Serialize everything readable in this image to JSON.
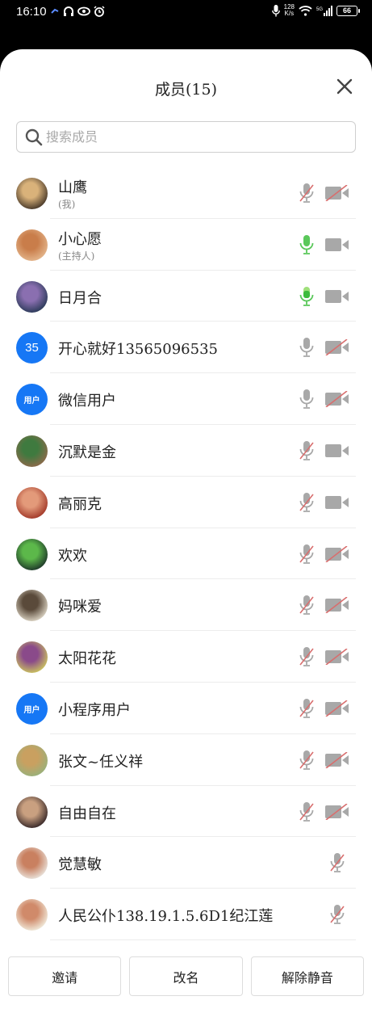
{
  "status_bar": {
    "time": "16:10",
    "speed_value": "128",
    "speed_unit": "K/s",
    "network": "5G",
    "battery": "66"
  },
  "header": {
    "title": "成员(15)"
  },
  "search": {
    "placeholder": "搜索成员",
    "value": ""
  },
  "colors": {
    "accent_blue": "#1677f5",
    "mic_active_green": "#5ac85a",
    "muted_red_slash": "#d86e6e",
    "icon_gray": "#a8a8a8"
  },
  "members": [
    {
      "name": "山鹰",
      "role": "(我)",
      "avatar_type": "photo",
      "avatar_colors": [
        "#4a3a2a",
        "#d9b27a"
      ],
      "mic": "muted",
      "camera": "off"
    },
    {
      "name": "小心愿",
      "role": "(主持人)",
      "avatar_type": "photo",
      "avatar_colors": [
        "#e3b48a",
        "#c97d4a"
      ],
      "mic": "active",
      "camera": "on"
    },
    {
      "name": "日月合",
      "role": "",
      "avatar_type": "photo",
      "avatar_colors": [
        "#2c3b5a",
        "#8a6fb0"
      ],
      "mic": "speaking",
      "camera": "on"
    },
    {
      "name": "开心就好13565096535",
      "role": "",
      "avatar_type": "text",
      "avatar_text": "35",
      "mic": "on",
      "camera": "off"
    },
    {
      "name": "微信用户",
      "role": "",
      "avatar_type": "text",
      "avatar_text": "用户",
      "mic": "on",
      "camera": "off"
    },
    {
      "name": "沉默是金",
      "role": "",
      "avatar_type": "photo",
      "avatar_colors": [
        "#8a6a4a",
        "#3f7a3f"
      ],
      "mic": "muted",
      "camera": "on"
    },
    {
      "name": "高丽克",
      "role": "",
      "avatar_type": "photo",
      "avatar_colors": [
        "#a33a2a",
        "#e39a7a"
      ],
      "mic": "muted",
      "camera": "on"
    },
    {
      "name": "欢欢",
      "role": "",
      "avatar_type": "photo",
      "avatar_colors": [
        "#1f3a2a",
        "#5cb84a"
      ],
      "mic": "muted",
      "camera": "off"
    },
    {
      "name": "妈咪爱",
      "role": "",
      "avatar_type": "photo",
      "avatar_colors": [
        "#d8d0c0",
        "#5a4a3a"
      ],
      "mic": "muted",
      "camera": "off"
    },
    {
      "name": "太阳花花",
      "role": "",
      "avatar_type": "photo",
      "avatar_colors": [
        "#c9c060",
        "#8a4a8a"
      ],
      "mic": "muted",
      "camera": "off"
    },
    {
      "name": "小程序用户",
      "role": "",
      "avatar_type": "text",
      "avatar_text": "用户",
      "mic": "muted",
      "camera": "off"
    },
    {
      "name": "张文~任义祥",
      "role": "",
      "avatar_type": "photo",
      "avatar_colors": [
        "#9ab07a",
        "#c9a060"
      ],
      "mic": "muted",
      "camera": "off"
    },
    {
      "name": "自由自在",
      "role": "",
      "avatar_type": "photo",
      "avatar_colors": [
        "#3a2a2a",
        "#c9a080"
      ],
      "mic": "muted",
      "camera": "off"
    },
    {
      "name": "觉慧敏",
      "role": "",
      "avatar_type": "photo",
      "avatar_colors": [
        "#e8e0d8",
        "#c98060"
      ],
      "mic": "muted",
      "camera": "none"
    },
    {
      "name": "人民公仆138.19.1.5.6D1纪江莲",
      "role": "",
      "avatar_type": "photo",
      "avatar_colors": [
        "#f0e8d8",
        "#d08a6a"
      ],
      "mic": "muted",
      "camera": "none"
    }
  ],
  "actions": {
    "invite": "邀请",
    "rename": "改名",
    "unmute": "解除静音"
  }
}
